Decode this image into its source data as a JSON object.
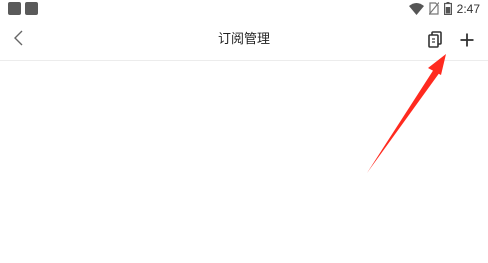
{
  "status_bar": {
    "time": "2:47",
    "left_icons": [
      "app-notification-icon",
      "app-notification-icon"
    ],
    "right_icons": [
      "wifi-icon",
      "no-sim-icon",
      "battery-icon"
    ]
  },
  "toolbar": {
    "title": "订阅管理",
    "back_icon": "chevron-left-icon",
    "clip_icon": "clipboard-icon",
    "add_icon": "plus-icon"
  },
  "colors": {
    "annotation_arrow": "#ff2a1f",
    "icon_dark": "#333333",
    "divider": "#ececec"
  }
}
